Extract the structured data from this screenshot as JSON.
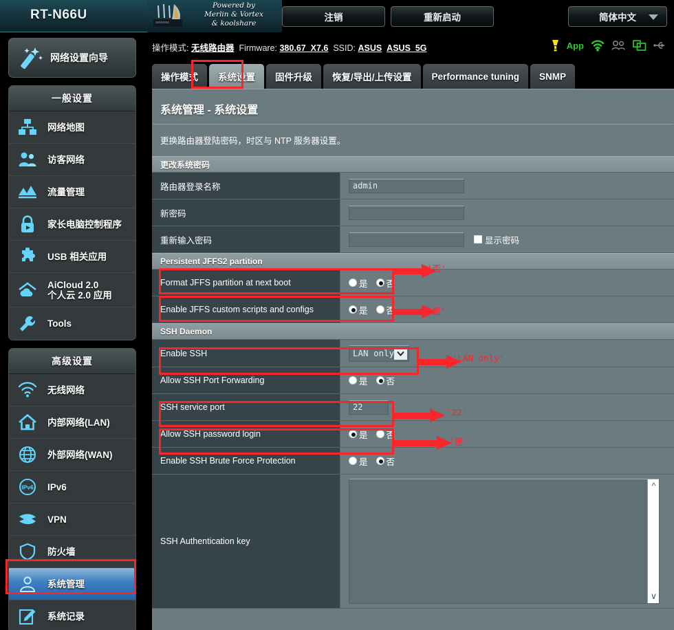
{
  "header": {
    "model": "RT-N66U",
    "logo_lines": [
      "Powered by",
      "Merlin & Vortex",
      "& koolshare"
    ],
    "logout_label": "注销",
    "reboot_label": "重新启动",
    "language": "简体中文"
  },
  "infostrip": {
    "mode_label": "操作模式:",
    "mode_value": "无线路由器",
    "firmware_label": "Firmware:",
    "firmware_value": "380.67_X7.6",
    "ssid_label": "SSID:",
    "ssid_1": "ASUS",
    "ssid_2": "ASUS_5G",
    "app_label": "App",
    "icons": [
      "notification-icon",
      "app-icon",
      "wifi-icon",
      "guest-users-icon",
      "screen-cast-icon",
      "usb-icon"
    ]
  },
  "sidebar": {
    "wizard_label": "网络设置向导",
    "general_header": "一般设置",
    "general_items": [
      {
        "label": "网络地图",
        "icon": "network-map-icon"
      },
      {
        "label": "访客网络",
        "icon": "guest-network-icon"
      },
      {
        "label": "流量管理",
        "icon": "traffic-manager-icon"
      },
      {
        "label": "家长电脑控制程序",
        "icon": "parental-control-icon"
      },
      {
        "label": "USB 相关应用",
        "icon": "usb-application-icon"
      },
      {
        "label": "AiCloud 2.0",
        "label2": "个人云 2.0 应用",
        "icon": "aicloud-icon"
      },
      {
        "label": "Tools",
        "icon": "tools-icon"
      }
    ],
    "advanced_header": "高级设置",
    "advanced_items": [
      {
        "label": "无线网络",
        "icon": "wireless-icon"
      },
      {
        "label": "内部网络(LAN)",
        "icon": "lan-icon"
      },
      {
        "label": "外部网络(WAN)",
        "icon": "wan-icon"
      },
      {
        "label": "IPv6",
        "icon": "ipv6-icon"
      },
      {
        "label": "VPN",
        "icon": "vpn-icon"
      },
      {
        "label": "防火墙",
        "icon": "firewall-icon"
      },
      {
        "label": "系统管理",
        "icon": "administration-icon",
        "active": true
      },
      {
        "label": "系统记录",
        "icon": "system-log-icon"
      }
    ]
  },
  "tabs": [
    {
      "label": "操作模式",
      "active": false
    },
    {
      "label": "系统设置",
      "active": true
    },
    {
      "label": "固件升级",
      "active": false
    },
    {
      "label": "恢复/导出/上传设置",
      "active": false
    },
    {
      "label": "Performance tuning",
      "active": false
    },
    {
      "label": "SNMP",
      "active": false
    }
  ],
  "panel": {
    "title": "系统管理 - 系统设置",
    "description": "更换路由器登陆密码，时区与 NTP 服务器设置。",
    "sections": [
      {
        "name": "更改系统密码",
        "rows": [
          {
            "label": "路由器登录名称",
            "type": "text",
            "value": "admin"
          },
          {
            "label": "新密码",
            "type": "text",
            "value": ""
          },
          {
            "label": "重新输入密码",
            "type": "text",
            "value": "",
            "checkbox_label": "显示密码",
            "checked": false
          }
        ]
      },
      {
        "name": "Persistent JFFS2 partition",
        "rows": [
          {
            "label": "Format JFFS partition at next boot",
            "type": "radio",
            "yes": "是",
            "no": "否",
            "selected": "no"
          },
          {
            "label": "Enable JFFS custom scripts and configs",
            "type": "radio",
            "yes": "是",
            "no": "否",
            "selected": "yes"
          }
        ]
      },
      {
        "name": "SSH Daemon",
        "rows": [
          {
            "label": "Enable SSH",
            "type": "select",
            "value": "LAN only"
          },
          {
            "label": "Allow SSH Port Forwarding",
            "type": "radio",
            "yes": "是",
            "no": "否",
            "selected": "no"
          },
          {
            "label": "SSH service port",
            "type": "text",
            "value": "22"
          },
          {
            "label": "Allow SSH password login",
            "type": "radio",
            "yes": "是",
            "no": "否",
            "selected": "yes"
          },
          {
            "label": "Enable SSH Brute Force Protection",
            "type": "radio",
            "yes": "是",
            "no": "否",
            "selected": "no"
          },
          {
            "label": "SSH Authentication key",
            "type": "textarea",
            "value": ""
          }
        ]
      }
    ]
  },
  "annotations": {
    "color": "#f8252a",
    "items": [
      {
        "text": "'否'"
      },
      {
        "text": "'是'"
      },
      {
        "text": "'LAN only'"
      },
      {
        "text": "'22'"
      },
      {
        "text": "'是'"
      }
    ]
  }
}
